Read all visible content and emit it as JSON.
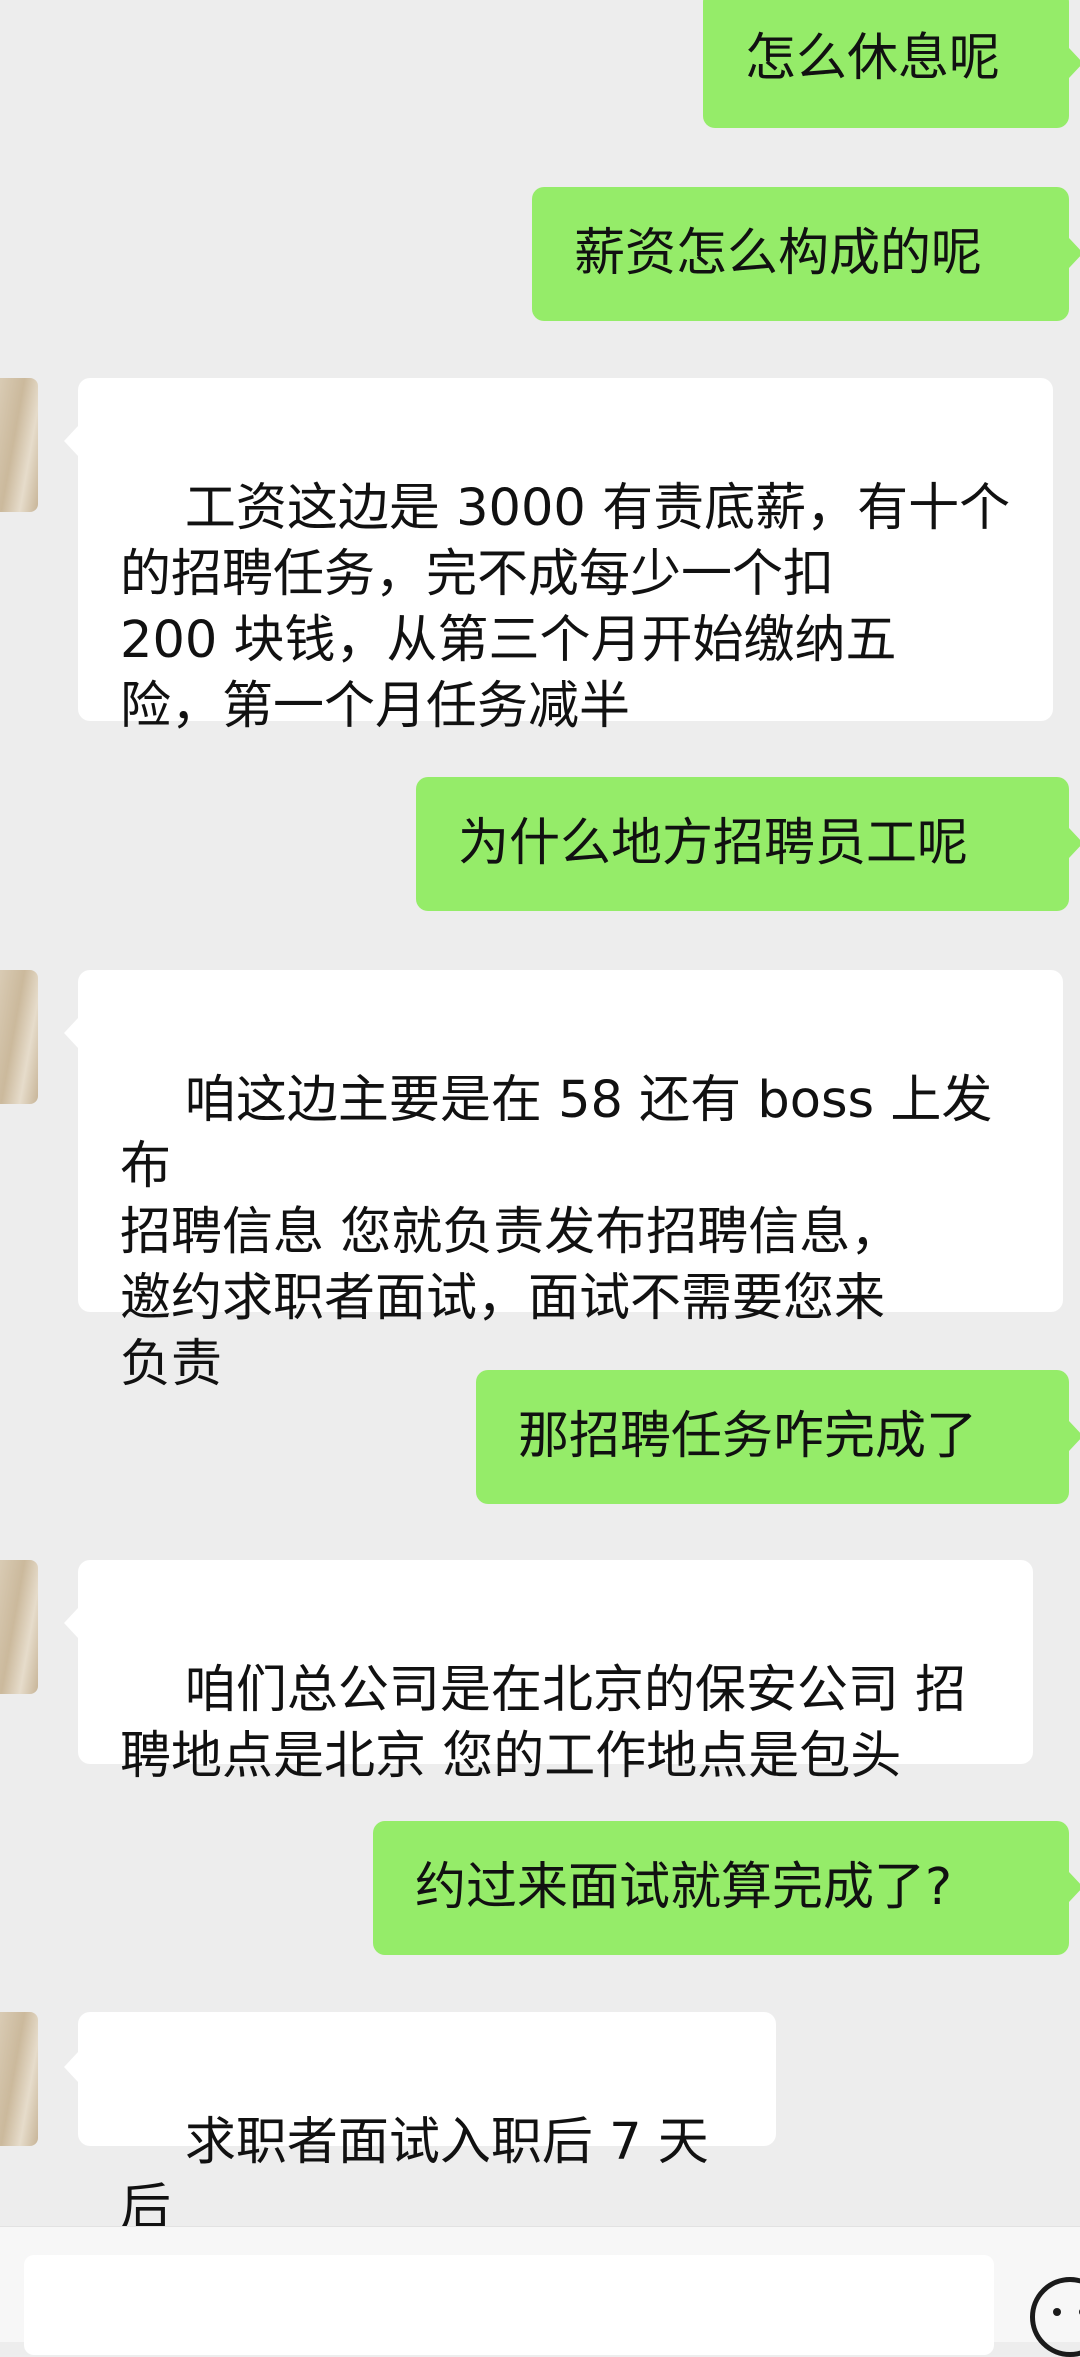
{
  "messages": [
    {
      "side": "sent",
      "text": "怎么休息呢"
    },
    {
      "side": "sent",
      "text": "薪资怎么构成的呢"
    },
    {
      "side": "received",
      "text": "工资这边是 3000 有责底薪，有十个\n的招聘任务，完不成每少一个扣\n200 块钱，从第三个月开始缴纳五\n险，第一个月任务减半"
    },
    {
      "side": "sent",
      "text": "为什么地方招聘员工呢"
    },
    {
      "side": "received",
      "text": "咱这边主要是在 58 还有 boss 上发布\n招聘信息 您就负责发布招聘信息，\n邀约求职者面试，面试不需要您来\n负责"
    },
    {
      "side": "sent",
      "text": "那招聘任务咋完成了"
    },
    {
      "side": "received",
      "text": "咱们总公司是在北京的保安公司 招\n聘地点是北京 您的工作地点是包头"
    },
    {
      "side": "sent",
      "text": "约过来面试就算完成了?"
    },
    {
      "side": "received",
      "text": "求职者面试入职后 7 天后"
    }
  ],
  "input": {
    "placeholder": ""
  },
  "icons": {
    "emoji": "emoji-face-icon",
    "avatar": "contact-avatar"
  },
  "colors": {
    "sent_bubble": "#95ec69",
    "received_bubble": "#ffffff",
    "background": "#ededed"
  }
}
